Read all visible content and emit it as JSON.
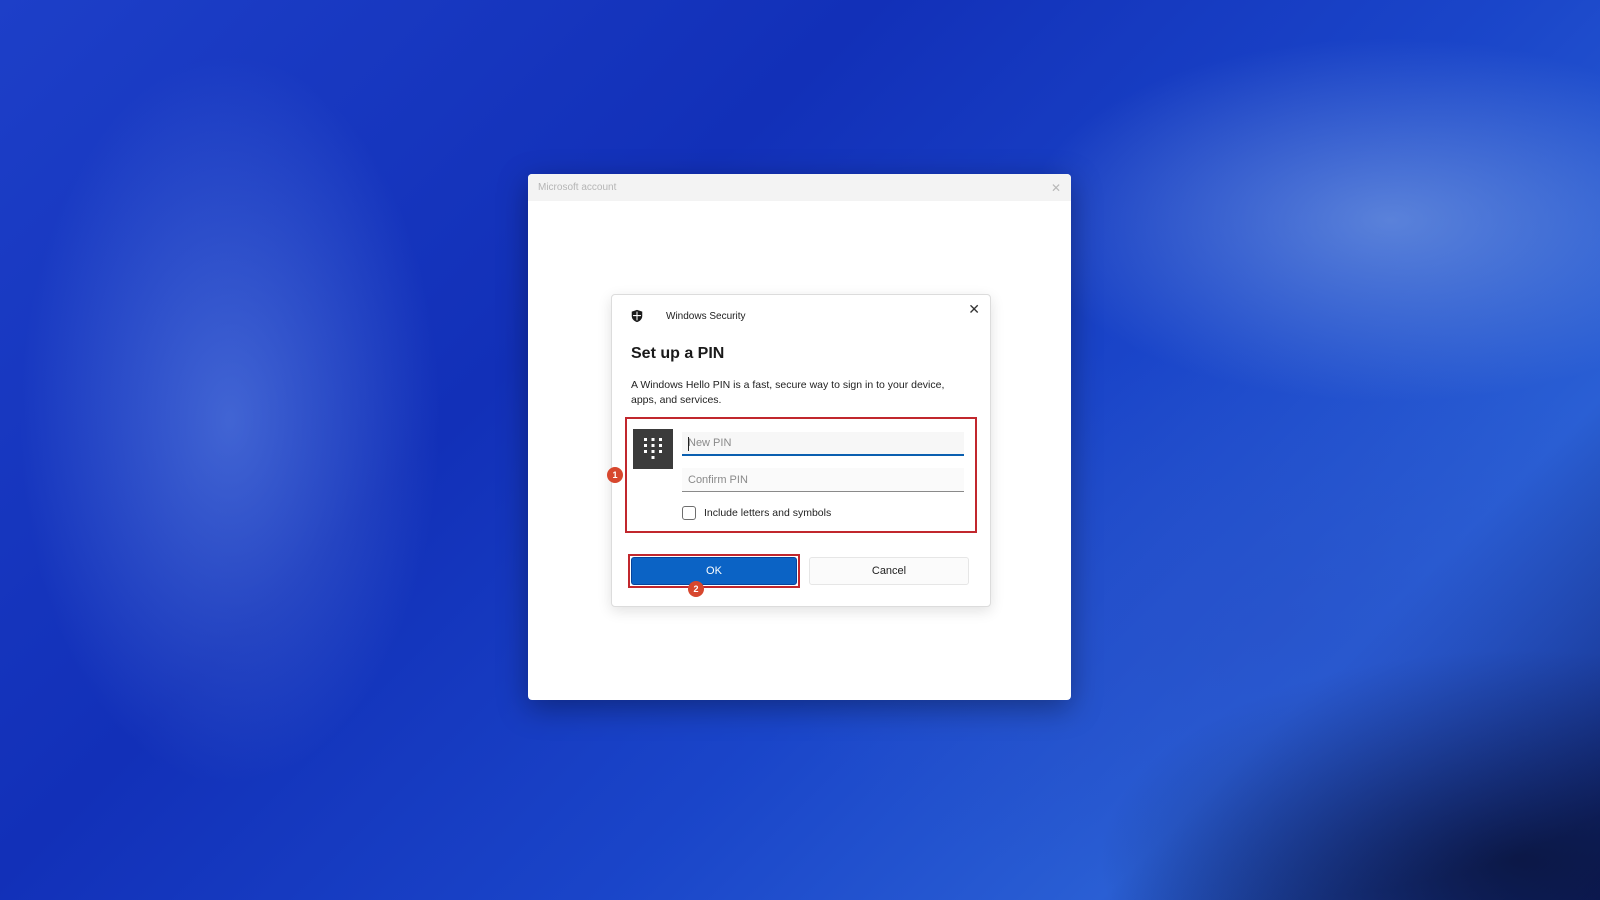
{
  "outer_window": {
    "title": "Microsoft account",
    "close_glyph": "✕"
  },
  "dialog": {
    "app_title": "Windows Security",
    "shield_icon": "shield-icon",
    "close_glyph": "✕",
    "heading": "Set up a PIN",
    "description": "A Windows Hello PIN is a fast, secure way to sign in to your device, apps, and services.",
    "keypad_icon": "keypad-icon",
    "new_pin": {
      "placeholder": "New PIN",
      "value": ""
    },
    "confirm_pin": {
      "placeholder": "Confirm PIN",
      "value": ""
    },
    "include_letters": {
      "label": "Include letters and symbols",
      "checked": false
    },
    "ok_label": "OK",
    "cancel_label": "Cancel"
  },
  "annotations": {
    "step1": "1",
    "step2": "2",
    "highlight_color": "#c1272d",
    "badge_color": "#d7472e"
  },
  "colors": {
    "accent": "#0b63c5",
    "background": "#1a3ec6"
  }
}
